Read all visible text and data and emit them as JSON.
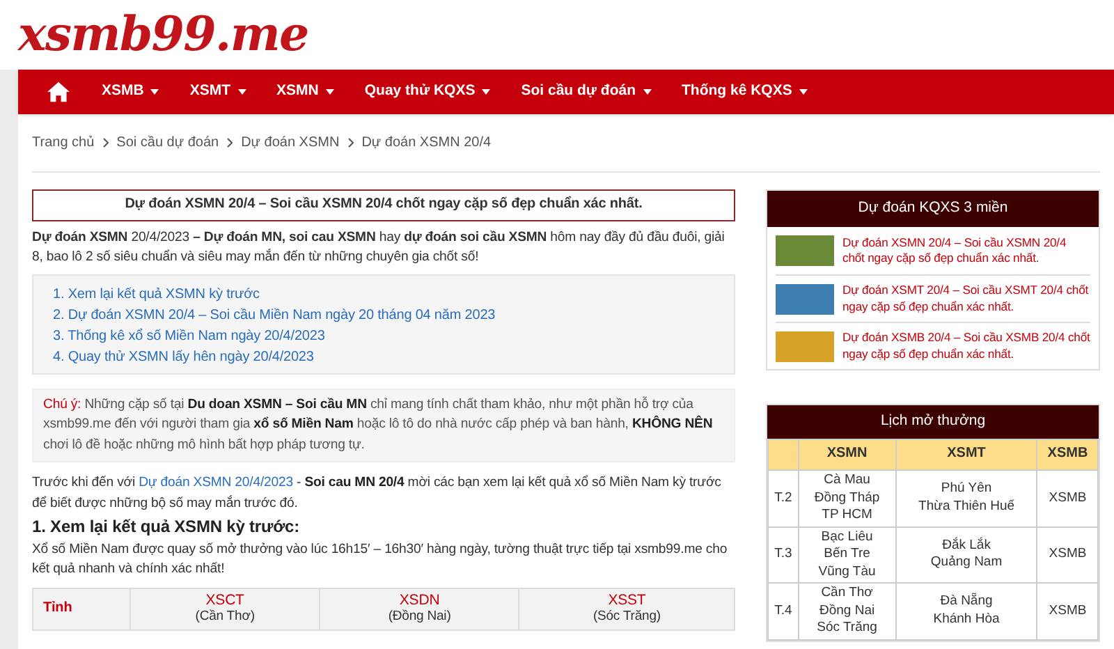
{
  "logo": "xsmb99.me",
  "nav": [
    {
      "kind": "home"
    },
    {
      "kind": "menu",
      "label": "XSMB"
    },
    {
      "kind": "menu",
      "label": "XSMT"
    },
    {
      "kind": "menu",
      "label": "XSMN"
    },
    {
      "kind": "menu",
      "label": "Quay thử KQXS"
    },
    {
      "kind": "menu",
      "label": "Soi cầu dự đoán"
    },
    {
      "kind": "menu",
      "label": "Thống kê KQXS"
    }
  ],
  "breadcrumb": [
    "Trang chủ",
    "Soi cầu dự đoán",
    "Dự đoán XSMN",
    "Dự đoán XSMN 20/4"
  ],
  "title": "Dự đoán XSMN 20/4 – Soi cầu XSMN 20/4 chốt ngay cặp số đẹp chuẩn xác nhất.",
  "intro": "**Dự đoán XSMN** 20/4/2023 **– Dự đoán MN, soi cau XSMN** hay **dự đoán soi cầu XSMN** hôm nay đầy đủ đầu đuôi, giải 8, bao lô 2 số siêu chuẩn và siêu may mắn đến từ những chuyên gia chốt số!",
  "toc": [
    "1. Xem lại kết quả XSMN kỳ trước",
    "2. Dự đoán XSMN 20/4 – Soi cầu Miền Nam ngày 20 tháng 04 năm 2023",
    "3. Thống kê xổ số Miền Nam ngày 20/4/2023",
    "4. Quay thử XSMN lấy hên ngày 20/4/2023"
  ],
  "note": [
    {
      "kind": "label",
      "text": "Chú ý:"
    },
    {
      "kind": "plain",
      "text": " Những cặp số tại "
    },
    {
      "kind": "bold",
      "text": "Du doan XSMN – Soi cầu MN"
    },
    {
      "kind": "plain",
      "text": " chỉ mang tính chất tham khảo, như một phần hỗ trợ của xsmb99.me đến với người tham gia "
    },
    {
      "kind": "bold",
      "text": "xổ số Miền Nam"
    },
    {
      "kind": "plain",
      "text": " hoặc lô tô do nhà nước cấp phép và ban hành, "
    },
    {
      "kind": "bold",
      "text": "KHÔNG NÊN"
    },
    {
      "kind": "plain",
      "text": " chơi lô đề hoặc những mô hình bất hợp pháp tương tự."
    }
  ],
  "lead": [
    {
      "kind": "plain",
      "text": "Trước khi đến với "
    },
    {
      "kind": "link",
      "text": "Dự đoán XSMN 20/4/2023"
    },
    {
      "kind": "plain",
      "text": " - "
    },
    {
      "kind": "bold",
      "text": "Soi cau MN 20/4"
    },
    {
      "kind": "plain",
      "text": " mời các bạn xem lại kết quả xổ số Miền Nam kỳ trước để biết được những bộ số may mắn trước đó."
    }
  ],
  "section_heading": "1. Xem lại kết quả XSMN kỳ trước:",
  "section_text": "Xổ số Miền Nam được quay số mở thưởng vào lúc 16h15′ – 16h30′ hàng ngày, tường thuật trực tiếp tại xsmb99.me cho kết quả nhanh và chính xác nhất!",
  "results_table": {
    "row_label": "Tỉnh",
    "columns": [
      {
        "code": "XSCT",
        "province": "(Cần Thơ)"
      },
      {
        "code": "XSDN",
        "province": "(Đồng Nai)"
      },
      {
        "code": "XSST",
        "province": "(Sóc Trăng)"
      }
    ]
  },
  "sidebar": {
    "predictions": {
      "title": "Dự đoán KQXS 3 miền",
      "items": [
        "Dự đoán XSMN 20/4 – Soi cầu XSMN 20/4 chốt ngay cặp số đẹp chuẩn xác nhất.",
        "Dự đoán XSMT 20/4 – Soi cầu XSMT 20/4 chốt ngay cặp số đẹp chuẩn xác nhất.",
        "Dự đoán XSMB 20/4 – Soi cầu XSMB 20/4 chốt ngay cặp số đẹp chuẩn xác nhất."
      ]
    },
    "schedule": {
      "title": "Lịch mở thưởng",
      "columns": [
        "XSMN",
        "XSMT",
        "XSMB"
      ],
      "rows": [
        {
          "day": "T.2",
          "xsmn": [
            "Cà Mau",
            "Đồng Tháp",
            "TP HCM"
          ],
          "xsmt": [
            "Phú Yên",
            "Thừa Thiên Huế"
          ],
          "xsmb": "XSMB"
        },
        {
          "day": "T.3",
          "xsmn": [
            "Bạc Liêu",
            "Bến Tre",
            "Vũng Tàu"
          ],
          "xsmt": [
            "Đắk Lắk",
            "Quảng Nam"
          ],
          "xsmb": "XSMB"
        },
        {
          "day": "T.4",
          "xsmn": [
            "Cần Thơ",
            "Đồng Nai",
            "Sóc Trăng"
          ],
          "xsmt": [
            "Đà Nẵng",
            "Khánh Hòa"
          ],
          "xsmb": "XSMB"
        }
      ]
    }
  }
}
